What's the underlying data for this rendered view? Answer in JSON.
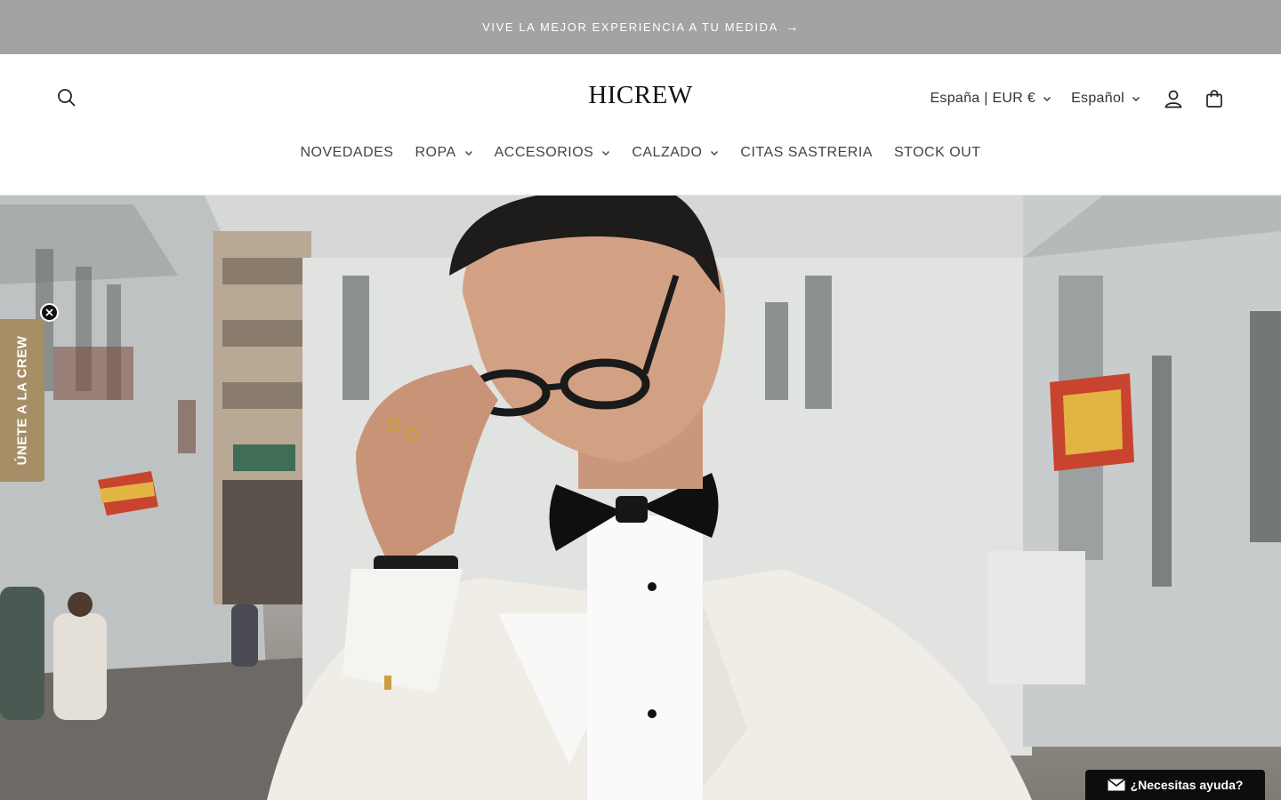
{
  "announcement": {
    "text": "VIVE LA MEJOR EXPERIENCIA A TU MEDIDA",
    "arrow": "→"
  },
  "header": {
    "logo": "HICREW",
    "country_selector": "España | EUR €",
    "language_selector": "Español"
  },
  "nav": {
    "items": [
      {
        "label": "NOVEDADES",
        "has_dropdown": false
      },
      {
        "label": "ROPA",
        "has_dropdown": true
      },
      {
        "label": "ACCESORIOS",
        "has_dropdown": true
      },
      {
        "label": "CALZADO",
        "has_dropdown": true
      },
      {
        "label": "CITAS SASTRERIA",
        "has_dropdown": false
      },
      {
        "label": "STOCK OUT",
        "has_dropdown": false
      }
    ]
  },
  "popup_tab": {
    "label": "ÚNETE A LA CREW"
  },
  "help_widget": {
    "label": "¿Necesitas ayuda?"
  },
  "icons": {
    "search": "search-icon",
    "account": "user-icon",
    "cart": "shopping-bag-icon",
    "chevron": "chevron-down-icon",
    "close": "close-icon",
    "mail": "mail-icon"
  },
  "colors": {
    "announcement_bg": "#a3a3a3",
    "popup_tab_bg": "#a68f66",
    "help_bg": "#0d0d0d"
  }
}
